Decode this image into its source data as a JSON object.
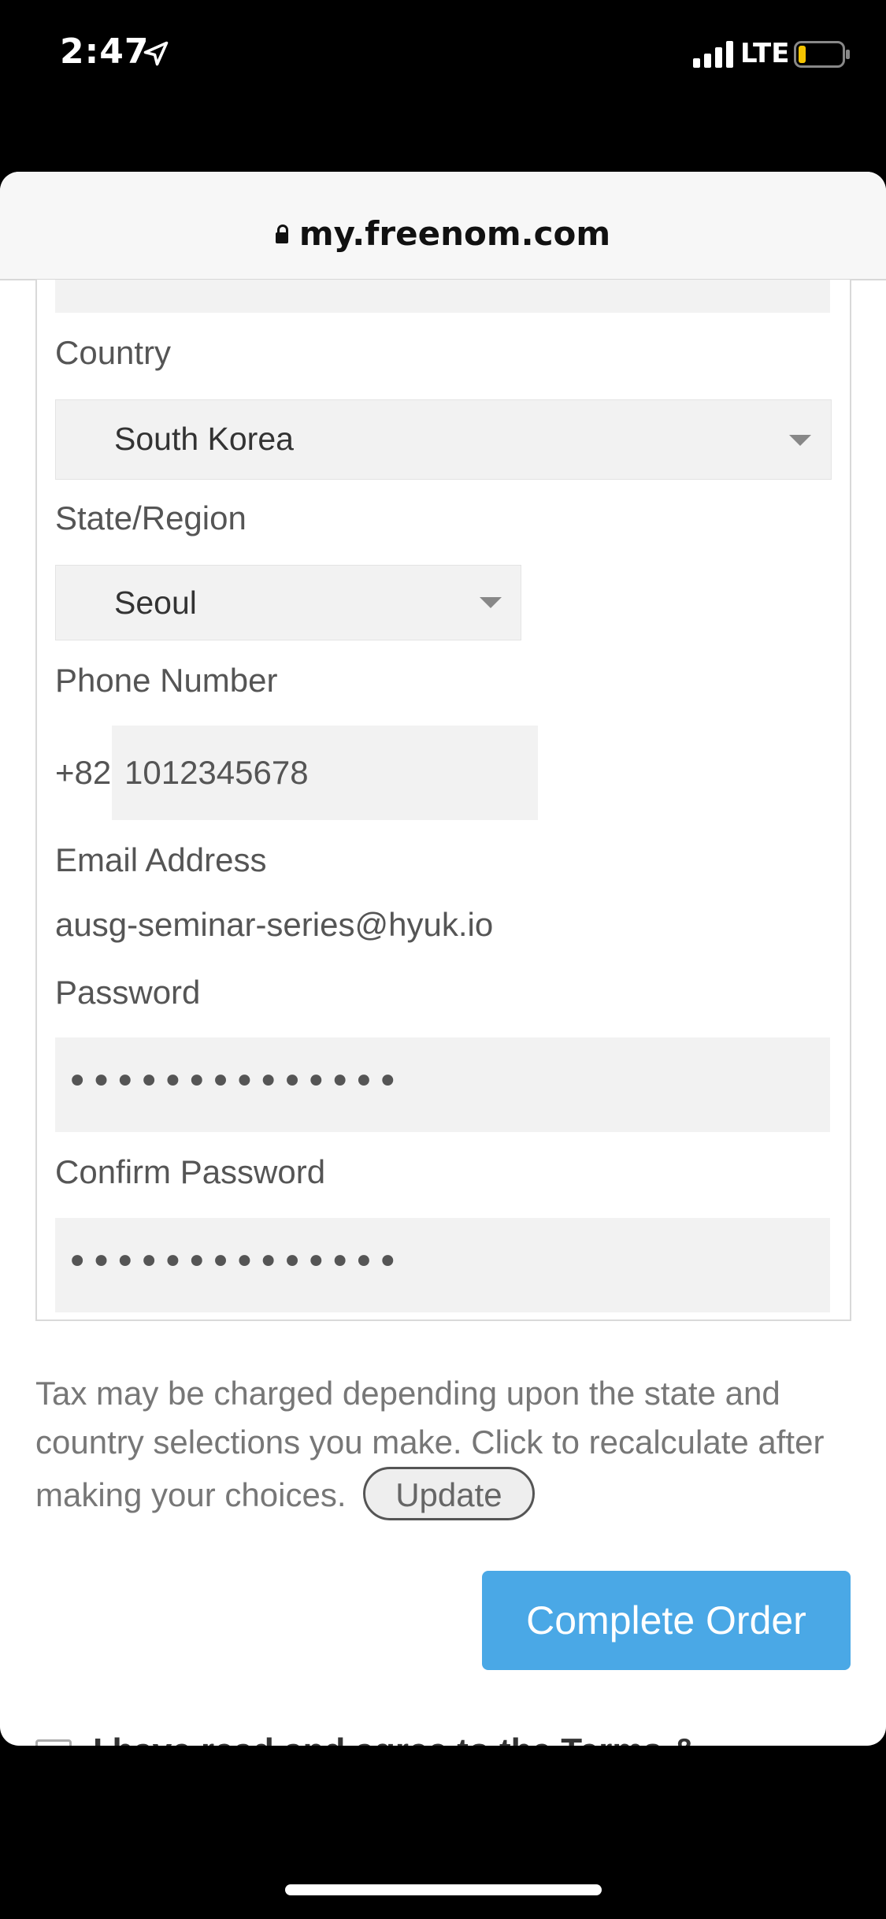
{
  "status_bar": {
    "time": "2:47",
    "network": "LTE"
  },
  "browser": {
    "url": "my.freenom.com"
  },
  "form": {
    "country": {
      "label": "Country",
      "value": "South Korea"
    },
    "state": {
      "label": "State/Region",
      "value": "Seoul"
    },
    "phone": {
      "label": "Phone Number",
      "prefix": "+82",
      "value": "1012345678"
    },
    "email": {
      "label": "Email Address",
      "value": "ausg-seminar-series@hyuk.io"
    },
    "password": {
      "label": "Password",
      "masked": "••••••••••••••"
    },
    "confirm_password": {
      "label": "Confirm Password",
      "masked": "••••••••••••••"
    }
  },
  "tax_note": {
    "text": "Tax may be charged depending upon the state and country selections you make. Click to recalculate after making your choices.",
    "update_label": "Update"
  },
  "complete_order_label": "Complete Order",
  "terms_partial": "I have read and agree to the Terms &",
  "colors": {
    "accent": "#4aa8e6",
    "field_bg": "#f2f2f2"
  }
}
